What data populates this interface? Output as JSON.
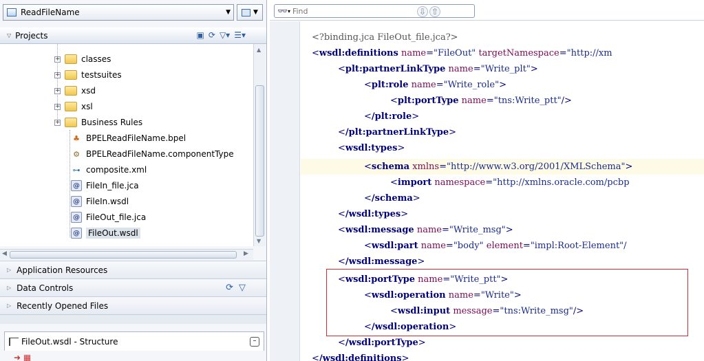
{
  "app_selector": {
    "label": "ReadFileName"
  },
  "projects_panel": {
    "title": "Projects"
  },
  "tree": {
    "items": [
      {
        "label": "classes",
        "type": "folder"
      },
      {
        "label": "testsuites",
        "type": "folder"
      },
      {
        "label": "xsd",
        "type": "folder"
      },
      {
        "label": "xsl",
        "type": "folder"
      },
      {
        "label": "Business Rules",
        "type": "folder"
      },
      {
        "label": "BPELReadFileName.bpel",
        "type": "bpel"
      },
      {
        "label": "BPELReadFileName.componentType",
        "type": "component"
      },
      {
        "label": "composite.xml",
        "type": "composite"
      },
      {
        "label": "FileIn_file.jca",
        "type": "file"
      },
      {
        "label": "FileIn.wsdl",
        "type": "file"
      },
      {
        "label": "FileOut_file.jca",
        "type": "file"
      },
      {
        "label": "FileOut.wsdl",
        "type": "file",
        "selected": true
      }
    ]
  },
  "accordions": {
    "application_resources": "Application Resources",
    "data_controls": "Data Controls",
    "recently_opened": "Recently Opened Files"
  },
  "structure_panel": {
    "title": "FileOut.wsdl - Structure"
  },
  "find": {
    "placeholder": "Find"
  },
  "code": {
    "l0": {
      "text": "<?binding.jca FileOut_file.jca?>"
    },
    "l1": {
      "tag": "wsdl:definitions",
      "a1": "name",
      "v1": "\"FileOut\"",
      "a2": "targetNamespace",
      "v2": "\"http://xm"
    },
    "l2": {
      "tag": "plt:partnerLinkType",
      "a1": "name",
      "v1": "\"Write_plt\""
    },
    "l3": {
      "tag": "plt:role",
      "a1": "name",
      "v1": "\"Write_role\""
    },
    "l4": {
      "tag": "plt:portType",
      "a1": "name",
      "v1": "\"tns:Write_ptt\""
    },
    "l5": {
      "tag": "/plt:role"
    },
    "l6": {
      "tag": "/plt:partnerLinkType"
    },
    "l7": {
      "tag": "wsdl:types"
    },
    "l8": {
      "tag": "schema",
      "a1": "xmlns",
      "v1": "\"http://www.w3.org/2001/XMLSchema\""
    },
    "l9": {
      "tag": "import",
      "a1": "namespace",
      "v1": "\"http://xmlns.oracle.com/pcbp"
    },
    "l10": {
      "tag": "/schema"
    },
    "l11": {
      "tag": "/wsdl:types"
    },
    "l12": {
      "tag": "wsdl:message",
      "a1": "name",
      "v1": "\"Write_msg\""
    },
    "l13": {
      "tag": "wsdl:part",
      "a1": "name",
      "v1": "\"body\"",
      "a2": "element",
      "v2": "\"impl:Root-Element\"/"
    },
    "l14": {
      "tag": "/wsdl:message"
    },
    "l15": {
      "tag": "wsdl:portType",
      "a1": "name",
      "v1": "\"Write_ptt\""
    },
    "l16": {
      "tag": "wsdl:operation",
      "a1": "name",
      "v1": "\"Write\""
    },
    "l17": {
      "tag": "wsdl:input",
      "a1": "message",
      "v1": "\"tns:Write_msg\""
    },
    "l18": {
      "tag": "/wsdl:operation"
    },
    "l19": {
      "tag": "/wsdl:portType"
    },
    "l20": {
      "tag": "/wsdl:definitions"
    }
  },
  "colors": {
    "highlight_box": "#d42a2a",
    "tag": "#00007a",
    "attribute": "#7a0a56",
    "value": "#1a2b8c"
  }
}
